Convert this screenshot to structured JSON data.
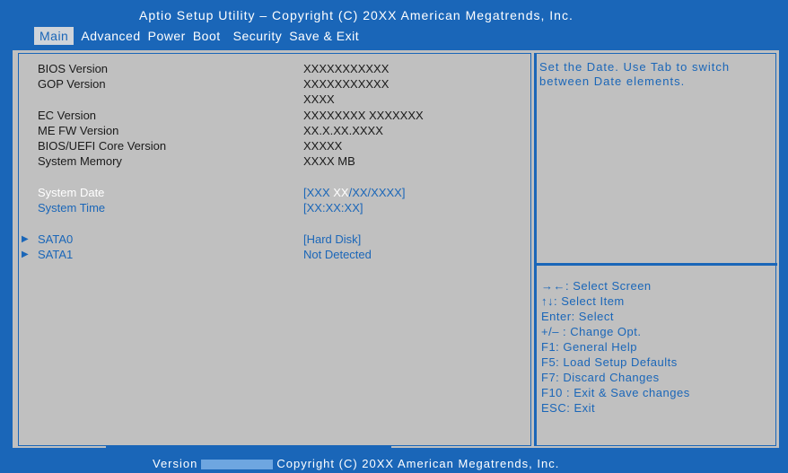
{
  "header": {
    "title": "Aptio Setup  Utility – Copyright  (C) 20XX American Megatrends,  Inc.",
    "tabs": [
      "Main",
      "Advanced",
      "Power",
      "Boot",
      "Security",
      "Save & Exit"
    ]
  },
  "main": {
    "rows": [
      {
        "label": "BIOS Version",
        "value": "XXXXXXXXXXX"
      },
      {
        "label": "GOP Version",
        "value": "XXXXXXXXXXX",
        "value2": "XXXX"
      },
      {
        "label": "EC Version",
        "value": "XXXXXXXX XXXXXXX"
      },
      {
        "label": "ME FW Version",
        "value": "XX.X.XX.XXXX"
      },
      {
        "label": "BIOS/UEFI Core Version",
        "value": "XXXXX"
      },
      {
        "label": "System Memory",
        "value": "XXXX MB"
      }
    ],
    "system_date": {
      "label": "System Date",
      "value_pre": "[XXX ",
      "value_hl": "XX",
      "value_post": "/XX/XXXX]"
    },
    "system_time": {
      "label": "System Time",
      "value": "[XX:XX:XX]"
    },
    "sata": [
      {
        "label": "SATA0",
        "value": "[Hard Disk]"
      },
      {
        "label": "SATA1",
        "value": "Not Detected"
      }
    ]
  },
  "help": {
    "text": "Set the Date. Use Tab to switch between Date elements.",
    "keys": [
      "→←:  Select Screen",
      "↑↓:  Select Item",
      "Enter:  Select",
      "+/– :  Change Opt.",
      "F1:  General  Help",
      "F5:  Load Setup Defaults",
      "F7:  Discard Changes",
      "F10 :  Exit & Save changes",
      "ESC:  Exit"
    ]
  },
  "footer": {
    "prefix": "Version",
    "text": "Copyright  (C)  20XX American Megatrends,  Inc."
  },
  "colors": {
    "accent": "#1a66b8",
    "panel": "#c0c0c0",
    "text": "#1a1a1a",
    "highlight": "#ffffff"
  }
}
